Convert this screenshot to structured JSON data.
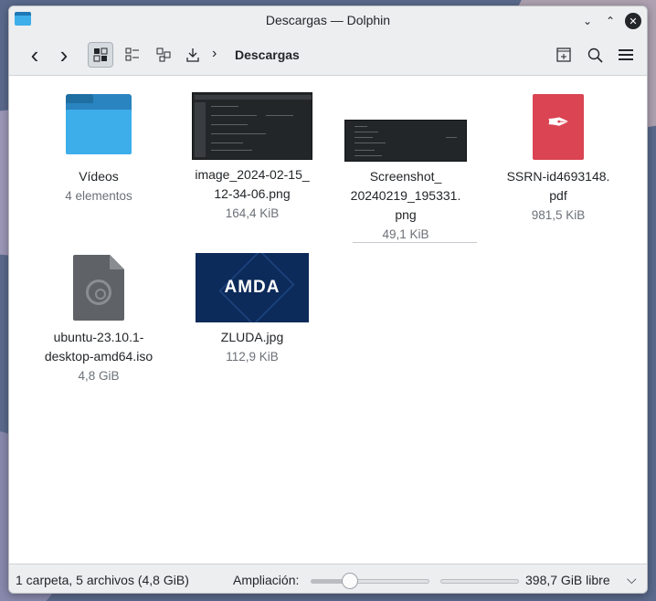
{
  "window": {
    "title": "Descargas — Dolphin",
    "controls": {
      "minimize": "⌄",
      "maximize": "⌃",
      "close": "✕"
    }
  },
  "toolbar": {
    "back_icon": "‹",
    "forward_icon": "›",
    "breadcrumb_sep": "›",
    "breadcrumb": "Descargas"
  },
  "files": [
    {
      "name": "Vídeos",
      "sub": "4 elementos",
      "type": "folder"
    },
    {
      "name": "image_2024-02-15_\n12-34-06.png",
      "name1": "image_2024-02-15_",
      "name2": "12-34-06.png",
      "size": "164,4 KiB",
      "type": "image"
    },
    {
      "name1": "Screenshot_",
      "name2": "20240219_195331.",
      "name3": "png",
      "size": "49,1 KiB",
      "type": "image"
    },
    {
      "name1": "SSRN-id4693148.",
      "name2": "pdf",
      "size": "981,5 KiB",
      "type": "pdf"
    },
    {
      "name1": "ubuntu-23.10.1-",
      "name2": "desktop-amd64.iso",
      "size": "4,8 GiB",
      "type": "iso"
    },
    {
      "name1": "ZLUDA.jpg",
      "size": "112,9 KiB",
      "type": "image",
      "thumb_text": "AMDA"
    }
  ],
  "status": {
    "summary": "1 carpeta, 5 archivos (4,8 GiB)",
    "zoom_label": "Ampliación:",
    "zoom_level": 0.33,
    "free_space": "398,7 GiB libre"
  },
  "colors": {
    "accent": "#3daee9",
    "pdf_red": "#da4453",
    "amd_blue": "#0c2a5a"
  }
}
